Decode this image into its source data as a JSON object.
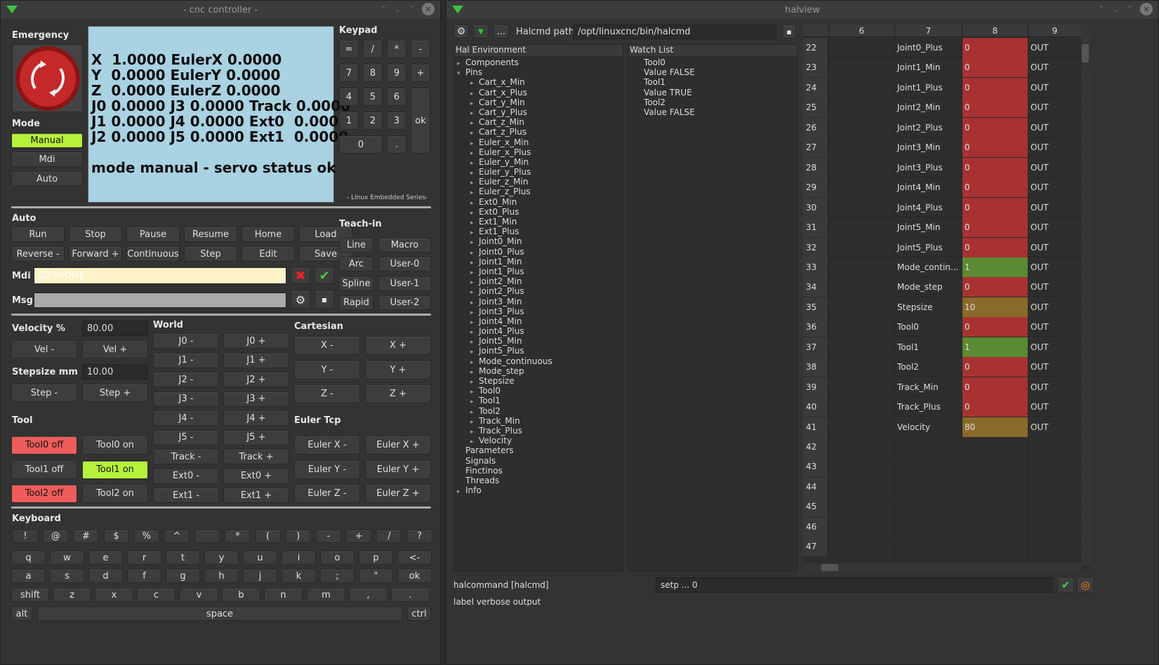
{
  "cnc": {
    "title": "- cnc controller -",
    "emergency_label": "Emergency",
    "mode_label": "Mode",
    "modes": [
      "Manual",
      "Mdi",
      "Auto"
    ],
    "display_lines": [
      "X  1.0000 EulerX 0.0000",
      "Y  0.0000 EulerY 0.0000",
      "Z  0.0000 EulerZ 0.0000",
      "J0 0.0000 J3 0.0000 Track 0.0000",
      "J1 0.0000 J4 0.0000 Ext0  0.0000",
      "J2 0.0000 J5 0.0000 Ext1  0.0000",
      "",
      "mode manual - servo status ok"
    ],
    "keypad_label": "Keypad",
    "keypad": {
      "row1": [
        "=",
        "/",
        "*",
        "-"
      ],
      "row2": [
        "7",
        "8",
        "9",
        "+"
      ],
      "row3": [
        "4",
        "5",
        "6"
      ],
      "row4": [
        "1",
        "2",
        "3"
      ],
      "zero": "0",
      "dot": ".",
      "ok": "ok"
    },
    "embedded_label": "- Linux Embedded Series-",
    "auto_label": "Auto",
    "auto_row1": [
      "Run",
      "Stop",
      "Pause",
      "Resume",
      "Home",
      "Load"
    ],
    "auto_row2": [
      "Reverse -",
      "Forward +",
      "Continuous",
      "Step",
      "Edit",
      "Save"
    ],
    "teachin_label": "Teach-in",
    "teachin": [
      [
        "Line",
        "Macro"
      ],
      [
        "Arc",
        "User-0"
      ],
      [
        "Spline",
        "User-1"
      ],
      [
        "Rapid",
        "User-2"
      ]
    ],
    "mdi_label": "Mdi",
    "mdi_value": "G28HOME",
    "msg_label": "Msg",
    "velocity_label": "Velocity %",
    "velocity_value": "80.00",
    "vel_minus": "Vel -",
    "vel_plus": "Vel +",
    "stepsize_label": "Stepsize mm",
    "stepsize_value": "10.00",
    "step_minus": "Step -",
    "step_plus": "Step +",
    "world_label": "World",
    "world": [
      [
        "J0 -",
        "J0 +"
      ],
      [
        "J1 -",
        "J1 +"
      ],
      [
        "J2 -",
        "J2 +"
      ],
      [
        "J3 -",
        "J3 +"
      ],
      [
        "J4 -",
        "J4 +"
      ],
      [
        "J5 -",
        "J5 +"
      ],
      [
        "Track -",
        "Track +"
      ],
      [
        "Ext0 -",
        "Ext0 +"
      ],
      [
        "Ext1 -",
        "Ext1 +"
      ]
    ],
    "cartesian_label": "Cartesian",
    "cartesian": [
      [
        "X -",
        "X +"
      ],
      [
        "Y -",
        "Y +"
      ],
      [
        "Z -",
        "Z +"
      ]
    ],
    "euler_label": "Euler Tcp",
    "euler": [
      [
        "Euler X -",
        "Euler X +"
      ],
      [
        "Euler Y -",
        "Euler Y +"
      ],
      [
        "Euler Z -",
        "Euler Z +"
      ]
    ],
    "tool_label": "Tool",
    "tools": [
      [
        "Tool0 off",
        "Tool0 on"
      ],
      [
        "Tool1 off",
        "Tool1 on"
      ],
      [
        "Tool2 off",
        "Tool2 on"
      ]
    ],
    "keyboard_label": "Keyboard",
    "kb_row1": [
      "!",
      "@",
      "#",
      "$",
      "%",
      "^",
      "",
      "*",
      "(",
      ")",
      "-",
      "+",
      "/",
      "?"
    ],
    "kb_row2": [
      "q",
      "w",
      "e",
      "r",
      "t",
      "y",
      "u",
      "i",
      "o",
      "p",
      "<-"
    ],
    "kb_row3": [
      "a",
      "s",
      "d",
      "f",
      "g",
      "h",
      "j",
      "k",
      ";",
      "\"",
      "ok"
    ],
    "kb_row4": [
      "shift",
      "z",
      "x",
      "c",
      "v",
      "b",
      "n",
      "m",
      ",",
      "."
    ],
    "kb_alt": "alt",
    "kb_space": "space",
    "kb_ctrl": "ctrl"
  },
  "halview": {
    "title": "halview",
    "path_label": "Halcmd path:",
    "path_value": "/opt/linuxcnc/bin/halcmd",
    "dots": "...",
    "env_header": "Hal Environment",
    "tree_top": [
      "Components",
      "Pins"
    ],
    "pins": [
      "Cart_x_Min",
      "Cart_x_Plus",
      "Cart_y_Min",
      "Cart_y_Plus",
      "Cart_z_Min",
      "Cart_z_Plus",
      "Euler_x_Min",
      "Euler_x_Plus",
      "Euler_y_Min",
      "Euler_y_Plus",
      "Euler_z_Min",
      "Euler_z_Plus",
      "Ext0_Min",
      "Ext0_Plus",
      "Ext1_Min",
      "Ext1_Plus",
      "Joint0_Min",
      "Joint0_Plus",
      "Joint1_Min",
      "Joint1_Plus",
      "Joint2_Min",
      "Joint2_Plus",
      "Joint3_Min",
      "Joint3_Plus",
      "Joint4_Min",
      "Joint4_Plus",
      "Joint5_Min",
      "Joint5_Plus",
      "Mode_continuous",
      "Mode_step",
      "Stepsize",
      "Tool0",
      "Tool1",
      "Tool2",
      "Track_Min",
      "Track_Plus",
      "Velocity"
    ],
    "tree_bottom": [
      "Parameters",
      "Signals",
      "Finctinos",
      "Threads",
      "Info"
    ],
    "watch_header": "Watch List",
    "watch": [
      "Tool0",
      "Value FALSE",
      "Tool1",
      "Value TRUE",
      "Tool2",
      "Value FALSE"
    ],
    "col_headers": [
      "6",
      "7",
      "8",
      "9"
    ],
    "rows": [
      {
        "n": "22",
        "name": "Joint0_Plus",
        "val": "0",
        "dir": "OUT",
        "color": "#a83232"
      },
      {
        "n": "23",
        "name": "Joint1_Min",
        "val": "0",
        "dir": "OUT",
        "color": "#a83232"
      },
      {
        "n": "24",
        "name": "Joint1_Plus",
        "val": "0",
        "dir": "OUT",
        "color": "#a83232"
      },
      {
        "n": "25",
        "name": "Joint2_Min",
        "val": "0",
        "dir": "OUT",
        "color": "#a83232"
      },
      {
        "n": "26",
        "name": "Joint2_Plus",
        "val": "0",
        "dir": "OUT",
        "color": "#a83232"
      },
      {
        "n": "27",
        "name": "Joint3_Min",
        "val": "0",
        "dir": "OUT",
        "color": "#a83232"
      },
      {
        "n": "28",
        "name": "Joint3_Plus",
        "val": "0",
        "dir": "OUT",
        "color": "#a83232"
      },
      {
        "n": "29",
        "name": "Joint4_Min",
        "val": "0",
        "dir": "OUT",
        "color": "#a83232"
      },
      {
        "n": "30",
        "name": "Joint4_Plus",
        "val": "0",
        "dir": "OUT",
        "color": "#a83232"
      },
      {
        "n": "31",
        "name": "Joint5_Min",
        "val": "0",
        "dir": "OUT",
        "color": "#a83232"
      },
      {
        "n": "32",
        "name": "Joint5_Plus",
        "val": "0",
        "dir": "OUT",
        "color": "#a83232"
      },
      {
        "n": "33",
        "name": "Mode_contin...",
        "val": "1",
        "dir": "OUT",
        "color": "#5a8a32"
      },
      {
        "n": "34",
        "name": "Mode_step",
        "val": "0",
        "dir": "OUT",
        "color": "#a83232"
      },
      {
        "n": "35",
        "name": "Stepsize",
        "val": "10",
        "dir": "OUT",
        "color": "#8a6a2a"
      },
      {
        "n": "36",
        "name": "Tool0",
        "val": "0",
        "dir": "OUT",
        "color": "#a83232"
      },
      {
        "n": "37",
        "name": "Tool1",
        "val": "1",
        "dir": "OUT",
        "color": "#5a8a32"
      },
      {
        "n": "38",
        "name": "Tool2",
        "val": "0",
        "dir": "OUT",
        "color": "#a83232"
      },
      {
        "n": "39",
        "name": "Track_Min",
        "val": "0",
        "dir": "OUT",
        "color": "#a83232"
      },
      {
        "n": "40",
        "name": "Track_Plus",
        "val": "0",
        "dir": "OUT",
        "color": "#a83232"
      },
      {
        "n": "41",
        "name": "Velocity",
        "val": "80",
        "dir": "OUT",
        "color": "#8a6a2a"
      },
      {
        "n": "42",
        "name": "",
        "val": "",
        "dir": "",
        "color": ""
      },
      {
        "n": "43",
        "name": "",
        "val": "",
        "dir": "",
        "color": ""
      },
      {
        "n": "44",
        "name": "",
        "val": "",
        "dir": "",
        "color": ""
      },
      {
        "n": "45",
        "name": "",
        "val": "",
        "dir": "",
        "color": ""
      },
      {
        "n": "46",
        "name": "",
        "val": "",
        "dir": "",
        "color": ""
      },
      {
        "n": "47",
        "name": "",
        "val": "",
        "dir": "",
        "color": ""
      }
    ],
    "cmd_label": "halcommand [halcmd]",
    "cmd_value": "setp ... 0",
    "verbose_label": "label verbose output"
  }
}
